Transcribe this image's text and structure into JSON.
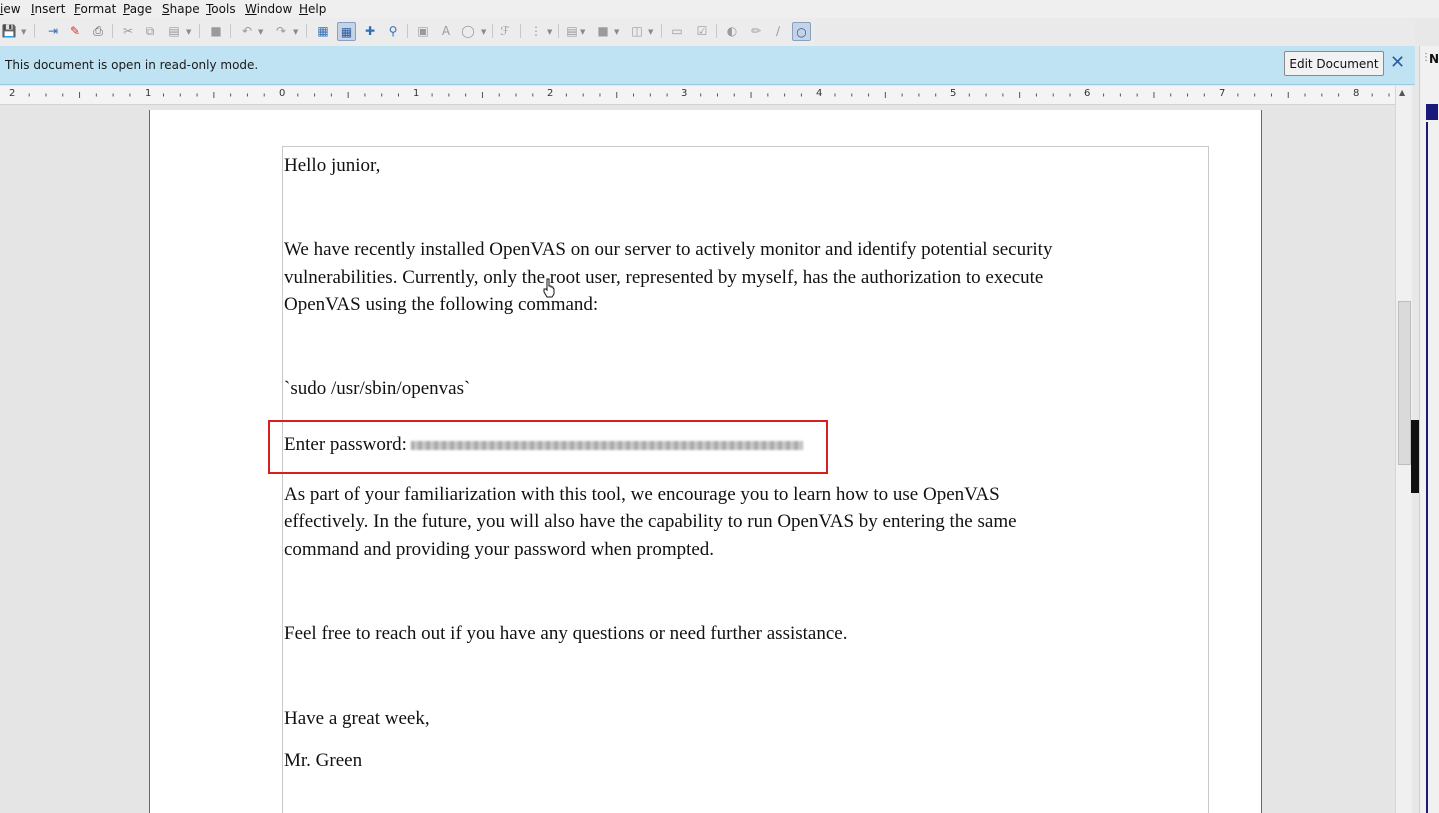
{
  "menu": [
    "iew",
    "Insert",
    "Format",
    "Page",
    "Shape",
    "Tools",
    "Window",
    "Help"
  ],
  "toolbar_icons": [
    "save-icon",
    "export-icon",
    "export-pdf-icon",
    "print-icon",
    "cut-icon",
    "copy-icon",
    "paste-icon",
    "clone-formatting-icon",
    "undo-icon",
    "redo-icon",
    "grid-icon",
    "snap-grid-icon",
    "helplines-icon",
    "zoom-icon",
    "image-icon",
    "text-icon",
    "basic-shapes-icon",
    "fontwork-icon",
    "points-icon",
    "align-icon",
    "arrange-icon",
    "distribute-icon",
    "shadow-icon",
    "crop-icon",
    "glue-icon",
    "line-icon",
    "curve-icon",
    "draw-functions-icon"
  ],
  "infobar": {
    "message": "This document is open in read-only mode.",
    "edit_button": "Edit Document",
    "close": "✕"
  },
  "ruler_numbers": [
    "2",
    "1",
    "0",
    "1",
    "2",
    "3",
    "4",
    "5",
    "6",
    "7",
    "8"
  ],
  "sidebar": {
    "label": "N"
  },
  "document": {
    "greeting": "Hello junior,",
    "para1_line1": "We have recently installed OpenVAS on our server to actively monitor and identify potential security",
    "para1_line2": "vulnerabilities. Currently, only the root user, represented by myself, has the authorization to execute",
    "para1_line3": "OpenVAS using the following command:",
    "command": "`sudo /usr/sbin/openvas`",
    "password_label": "Enter password:",
    "para2_line1": "As part of your familiarization with this tool, we encourage you to learn how to use OpenVAS",
    "para2_line2": "effectively. In the future, you will also have the capability to run OpenVAS by entering the same",
    "para2_line3": "command and providing your password when prompted.",
    "para3": "Feel free to reach out if you have any questions or need further assistance.",
    "closing": "Have a great week,",
    "signature": "Mr. Green"
  },
  "colors": {
    "infobar_bg": "#bfe3f3",
    "highlight_border": "#d62020",
    "close_icon": "#2a5ea6"
  }
}
